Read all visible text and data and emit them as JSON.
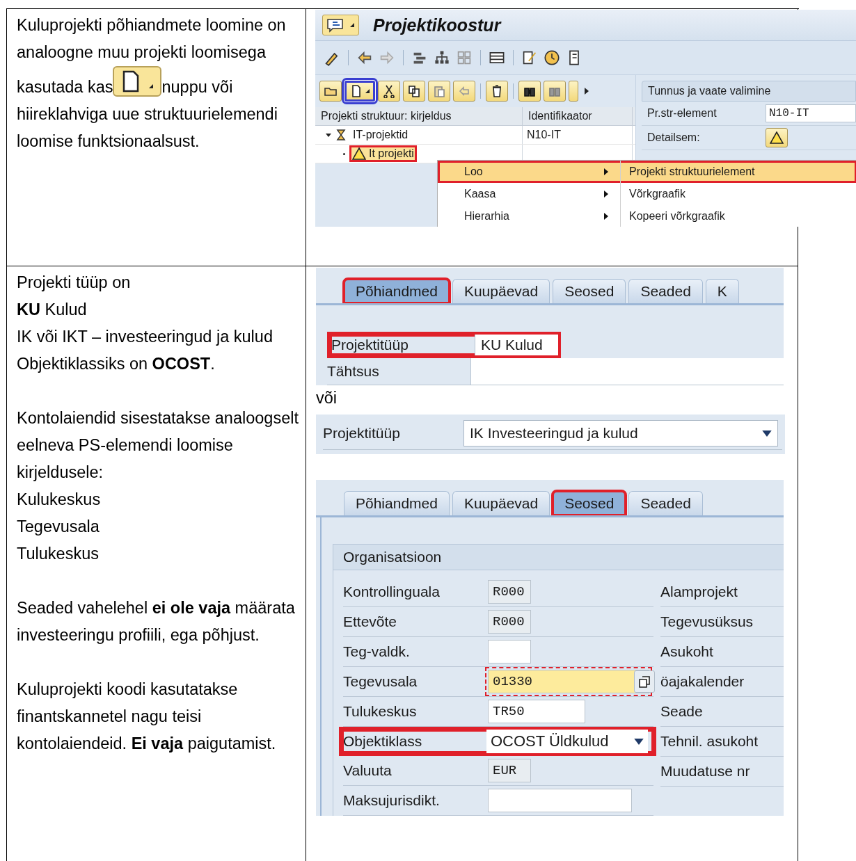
{
  "intro": {
    "lead": "Kuluprojekti põhiandmete loomine on analoogne muu projekti loomisega",
    "before_button": "kasutada kas",
    "after_button": "nuppu või",
    "continuation": "hiireklahviga uue struktuurielemendi loomise funktsionaalsust."
  },
  "builder": {
    "title": "Projektikoostur",
    "new_button_highlighted": true,
    "tree": {
      "columns": [
        "Projekti struktuur: kirjeldus",
        "Identifikaator"
      ],
      "rows": [
        {
          "label": "IT-projektid",
          "id": "N10-IT",
          "expanded": true,
          "highlighted": false,
          "children": [
            {
              "label": "It projekti",
              "highlighted": true
            }
          ]
        }
      ]
    },
    "context_menu": [
      {
        "label": "Loo",
        "submenu_item": "Projekti struktuurielement",
        "selected": true
      },
      {
        "label": "Kaasa",
        "submenu_item": "Võrkgraafik",
        "selected": false
      },
      {
        "label": "Hierarhia",
        "submenu_item": "Kopeeri võrkgraafik",
        "selected": false
      }
    ],
    "detail_panel": {
      "title": "Tunnus ja vaate valimine",
      "element_label": "Pr.str-element",
      "element_value": "N10-IT",
      "detail_label": "Detailsem:"
    }
  },
  "notes": [
    [
      "Projekti tüüp on",
      "**KU** Kulud",
      "IK või IKT – investeeringud ja kulud",
      "Objektiklassiks on **OCOST**."
    ],
    [
      "Kontolaiendid sisestatakse analoogselt eelneva PS-elemendi loomise kirjeldusele:",
      "Kulukeskus",
      "Tegevusala",
      "Tulukeskus"
    ],
    [
      "Seaded vahelehel **ei ole vaja** määrata investeeringu profiili, ega põhjust."
    ],
    [
      "Kuluprojekti koodi kasutatakse finantskannetel nagu teisi kontolaiendeid. **Ei vaja** paigutamist."
    ]
  ],
  "basic_data_screen": {
    "tabs": [
      {
        "label": "Põhiandmed",
        "selected": true
      },
      {
        "label": "Kuupäevad",
        "selected": false
      },
      {
        "label": "Seosed",
        "selected": false
      },
      {
        "label": "Seaded",
        "selected": false
      },
      {
        "label": "K",
        "selected": false
      }
    ],
    "fields": [
      {
        "label": "Projektitüüp",
        "value": "KU Kulud",
        "highlighted": true
      },
      {
        "label": "Tähtsus",
        "highlighted": false
      }
    ]
  },
  "or_text": "või",
  "alt_type_field": {
    "label": "Projektitüüp",
    "value": "IK Investeeringud ja kulud"
  },
  "relations_screen": {
    "tabs": [
      {
        "label": "Põhiandmed",
        "selected": false
      },
      {
        "label": "Kuupäevad",
        "selected": false
      },
      {
        "label": "Seosed",
        "selected": true
      },
      {
        "label": "Seaded",
        "selected": false
      }
    ],
    "group_title": "Organisatsioon",
    "left_fields": [
      {
        "label": "Kontrollinguala",
        "value": "R000",
        "kind": "readonly",
        "highlighted": false
      },
      {
        "label": "Ettevõte",
        "value": "R000",
        "kind": "readonly",
        "highlighted": false
      },
      {
        "label": "Teg-valdk.",
        "kind": "short_input",
        "highlighted": false
      },
      {
        "label": "Tegevusala",
        "value": "01330",
        "kind": "required",
        "highlighted": false
      },
      {
        "label": "Tulukeskus",
        "value": "TR50",
        "kind": "input",
        "highlighted": false
      },
      {
        "label": "Objektiklass",
        "value": "OCOST Üldkulud",
        "kind": "dropdown",
        "highlighted": true
      },
      {
        "label": "Valuuta",
        "value": "EUR",
        "kind": "readonly",
        "highlighted": false
      },
      {
        "label": "Maksujurisdikt.",
        "kind": "long_input",
        "highlighted": false
      }
    ],
    "right_labels": [
      {
        "label": "Alamprojekt",
        "kind": "text"
      },
      {
        "label": "Tegevusüksus",
        "kind": "text"
      },
      {
        "label": "Asukoht",
        "kind": "text"
      },
      {
        "label": "öajakalender",
        "kind": "with_button"
      },
      {
        "label": "Seade",
        "kind": "text"
      },
      {
        "label": "Tehnil. asukoht",
        "kind": "text"
      },
      {
        "label": "Muudatuse nr",
        "kind": "text"
      }
    ]
  }
}
